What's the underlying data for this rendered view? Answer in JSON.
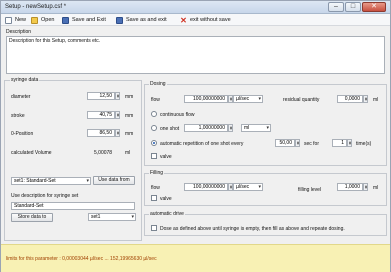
{
  "window": {
    "title": "Setup - newSetup.csf *"
  },
  "toolbar": {
    "new": "New",
    "open": "Open",
    "save_exit": "Save and Exit",
    "save_as_exit": "Save as and exit",
    "exit_no_save": "exit without save"
  },
  "description": {
    "title": "Description",
    "text": "Description for this Setup, comments etc."
  },
  "syringe": {
    "title": "syringe data",
    "diameter_label": "diameter",
    "diameter_value": "12,50",
    "diameter_unit": "mm",
    "stroke_label": "stroke",
    "stroke_value": "40,75",
    "stroke_unit": "mm",
    "zero_label": "0-Position",
    "zero_value": "86,50",
    "zero_unit": "mm",
    "calc_label": "calculated Volume",
    "calc_value": "5,00078",
    "calc_unit": "ml",
    "set_select": "set1: Standard-Set",
    "use_data_btn": "Use data from",
    "use_desc_label": "Use description for syringe set",
    "set_desc": "Standard-Set",
    "store_btn": "Store data to",
    "store_select": "set1"
  },
  "dosing": {
    "title": "Dosing",
    "flow_label": "flow",
    "flow_value": "100,00000000",
    "flow_unit": "µl/sec",
    "residual_label": "residual quantity",
    "residual_value": "0,0000",
    "residual_unit": "ml",
    "continuous": "continuous flow",
    "oneshot": "one shot",
    "oneshot_value": "1,00000000",
    "oneshot_unit": "ml",
    "auto_label": "automatic repetition of one shot every",
    "auto_value": "50,00",
    "sec_for": "sec  for",
    "times_value": "1",
    "times_label": "time(s)",
    "valve": "valve"
  },
  "filling": {
    "title": "Filling",
    "flow_label": "flow",
    "flow_value": "100,00000000",
    "flow_unit": "µl/sec",
    "level_label": "filling level",
    "level_value": "1,0000",
    "level_unit": "ml",
    "valve": "valve"
  },
  "auto_drive": {
    "title": "automatic drive",
    "text": "Dose as defined above until syringe is empty, then fill as above and repeate dosing."
  },
  "status": {
    "text": "limits for this parameter :  0,00003044 µl/sec  ...  152,19965630 µl/sec"
  },
  "colors": {
    "status_bg": "#f8f1b4",
    "status_text": "#a04000",
    "accent": "#1e58b0"
  }
}
